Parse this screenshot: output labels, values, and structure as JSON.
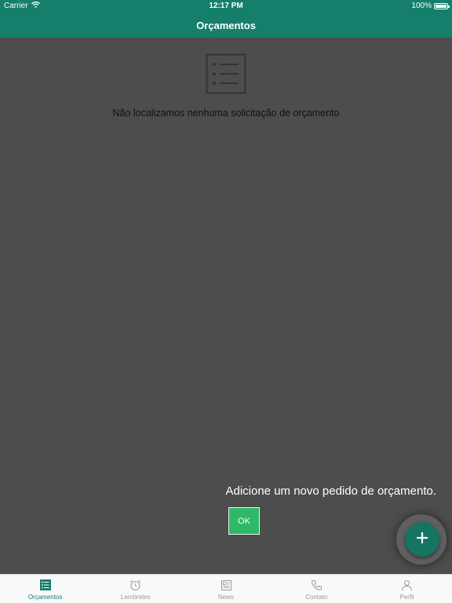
{
  "status_bar": {
    "carrier": "Carrier",
    "time": "12:17 PM",
    "battery": "100%",
    "wifi_icon": "wifi-icon",
    "battery_icon": "battery-icon"
  },
  "nav": {
    "title": "Orçamentos"
  },
  "empty_state": {
    "icon": "list-icon",
    "message": "Não localizamos nenhuma solicitação de orçamento"
  },
  "coach_mark": {
    "text": "Adicione um novo pedido de orçamento.",
    "ok_label": "OK"
  },
  "fab": {
    "icon": "plus-icon"
  },
  "tabs": [
    {
      "label": "Orçamentos",
      "icon": "list-icon",
      "active": true
    },
    {
      "label": "Lembretes",
      "icon": "alarm-clock-icon",
      "active": false
    },
    {
      "label": "News",
      "icon": "newspaper-icon",
      "active": false
    },
    {
      "label": "Contato",
      "icon": "phone-icon",
      "active": false
    },
    {
      "label": "Perfil",
      "icon": "person-icon",
      "active": false
    }
  ],
  "colors": {
    "primary": "#157f6b",
    "overlay": "#4d4d4d",
    "ok_button": "#2fb867",
    "tab_inactive": "#9a9a9a"
  }
}
